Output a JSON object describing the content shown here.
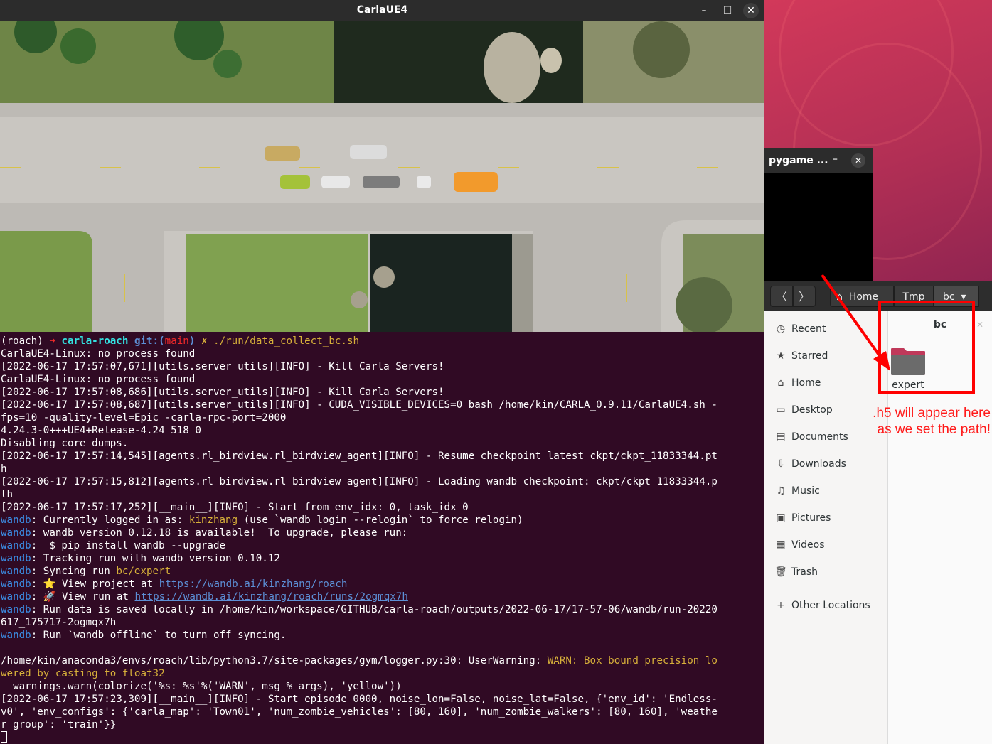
{
  "carla_window": {
    "title": "CarlaUE4",
    "minimize_label": "–",
    "maximize_label": "☐",
    "close_label": "✕"
  },
  "terminal": {
    "prompt": {
      "env": "(roach)",
      "arrow": "➜",
      "dir": "carla-roach",
      "git_prefix": "git:(",
      "branch": "main",
      "git_suffix": ")",
      "dirty": "✗",
      "command": "./run/data_collect_bc.sh"
    },
    "lines": [
      "CarlaUE4-Linux: no process found",
      "[2022-06-17 17:57:07,671][utils.server_utils][INFO] - Kill Carla Servers!",
      "CarlaUE4-Linux: no process found",
      "[2022-06-17 17:57:08,686][utils.server_utils][INFO] - Kill Carla Servers!",
      "[2022-06-17 17:57:08,687][utils.server_utils][INFO] - CUDA_VISIBLE_DEVICES=0 bash /home/kin/CARLA_0.9.11/CarlaUE4.sh -",
      "fps=10 -quality-level=Epic -carla-rpc-port=2000",
      "4.24.3-0+++UE4+Release-4.24 518 0",
      "Disabling core dumps.",
      "[2022-06-17 17:57:14,545][agents.rl_birdview.rl_birdview_agent][INFO] - Resume checkpoint latest ckpt/ckpt_11833344.pt",
      "h",
      "[2022-06-17 17:57:15,812][agents.rl_birdview.rl_birdview_agent][INFO] - Loading wandb checkpoint: ckpt/ckpt_11833344.p",
      "th",
      "[2022-06-17 17:57:17,252][__main__][INFO] - Start from env_idx: 0, task_idx 0"
    ],
    "wandb_prefix": "wandb",
    "wandb_login_pre": ": Currently logged in as: ",
    "wandb_user": "kinzhang",
    "wandb_login_post": " (use `wandb login --relogin` to force relogin)",
    "wandb_version": ": wandb version 0.12.18 is available!  To upgrade, please run:",
    "wandb_pip": ":  $ pip install wandb --upgrade",
    "wandb_tracking": ": Tracking run with wandb version 0.10.12",
    "wandb_syncing_pre": ": Syncing run ",
    "wandb_run_name": "bc/expert",
    "wandb_project_pre": ": ⭐ View project at ",
    "wandb_project_url": "https://wandb.ai/kinzhang/roach",
    "wandb_run_pre": ": 🚀 View run at ",
    "wandb_run_url": "https://wandb.ai/kinzhang/roach/runs/2ogmqx7h",
    "wandb_saved": ": Run data is saved locally in /home/kin/workspace/GITHUB/carla-roach/outputs/2022-06-17/17-57-06/wandb/run-20220",
    "wandb_saved_cont": "617_175717-2ogmqx7h",
    "wandb_offline": ": Run `wandb offline` to turn off syncing.",
    "warn_pre": "/home/kin/anaconda3/envs/roach/lib/python3.7/site-packages/gym/logger.py:30: UserWarning: ",
    "warn_msg": "WARN: Box bound precision lo",
    "warn_msg_cont": "wered by casting to float32",
    "warn_call": "  warnings.warn(colorize('%s: %s'%('WARN', msg % args), 'yellow'))",
    "tail": [
      "[2022-06-17 17:57:23,309][__main__][INFO] - Start episode 0000, noise_lon=False, noise_lat=False, {'env_id': 'Endless-",
      "v0', 'env_configs': {'carla_map': 'Town01', 'num_zombie_vehicles': [80, 160], 'num_zombie_walkers': [80, 160], 'weathe",
      "r_group': 'train'}}"
    ]
  },
  "pygame_window": {
    "title": "pygame ...",
    "minimize_label": "–",
    "close_label": "✕"
  },
  "files_window": {
    "back_label": "〈",
    "forward_label": "〉",
    "breadcrumbs": [
      "Home",
      "Tmp",
      "bc"
    ],
    "menu_arrow": "▾",
    "tab_label": "bc",
    "tab_close": "✕",
    "sidebar": [
      {
        "icon": "clock-icon",
        "glyph": "◷",
        "label": "Recent"
      },
      {
        "icon": "star-icon",
        "glyph": "★",
        "label": "Starred"
      },
      {
        "icon": "home-icon",
        "glyph": "⌂",
        "label": "Home"
      },
      {
        "icon": "desktop-icon",
        "glyph": "▭",
        "label": "Desktop"
      },
      {
        "icon": "documents-icon",
        "glyph": "▤",
        "label": "Documents"
      },
      {
        "icon": "download-icon",
        "glyph": "⇩",
        "label": "Downloads"
      },
      {
        "icon": "music-icon",
        "glyph": "♫",
        "label": "Music"
      },
      {
        "icon": "pictures-icon",
        "glyph": "▣",
        "label": "Pictures"
      },
      {
        "icon": "videos-icon",
        "glyph": "▦",
        "label": "Videos"
      },
      {
        "icon": "trash-icon",
        "glyph": "🗑",
        "label": "Trash"
      },
      {
        "icon": "plus-icon",
        "glyph": "+",
        "label": "Other Locations"
      }
    ],
    "folder": {
      "label": "expert",
      "color": "#6b6b6b",
      "tab_color": "#c0395a"
    }
  },
  "annotation": {
    "line1": ".h5 will appear here",
    "line2": "as we set the path!",
    "color": "#ff0000"
  }
}
